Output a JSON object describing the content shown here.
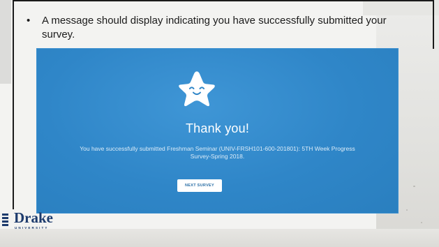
{
  "slide": {
    "bullet_symbol": "•",
    "bullet_text": "A message should display indicating you have successfully submitted your survey."
  },
  "survey_panel": {
    "star_icon": "smiling-star-icon",
    "heading": "Thank you!",
    "message": "You have successfully submitted Freshman Seminar (UNIV-FRSH101-600-201801): 5TH Week Progress Survey-Spring 2018.",
    "next_button_label": "NEXT SURVEY"
  },
  "logo": {
    "word": "Drake",
    "subtitle": "UNIVERSITY"
  },
  "colors": {
    "panel_blue": "#2f86c8",
    "logo_navy": "#1d3b6d",
    "button_text": "#2b6fa6"
  }
}
